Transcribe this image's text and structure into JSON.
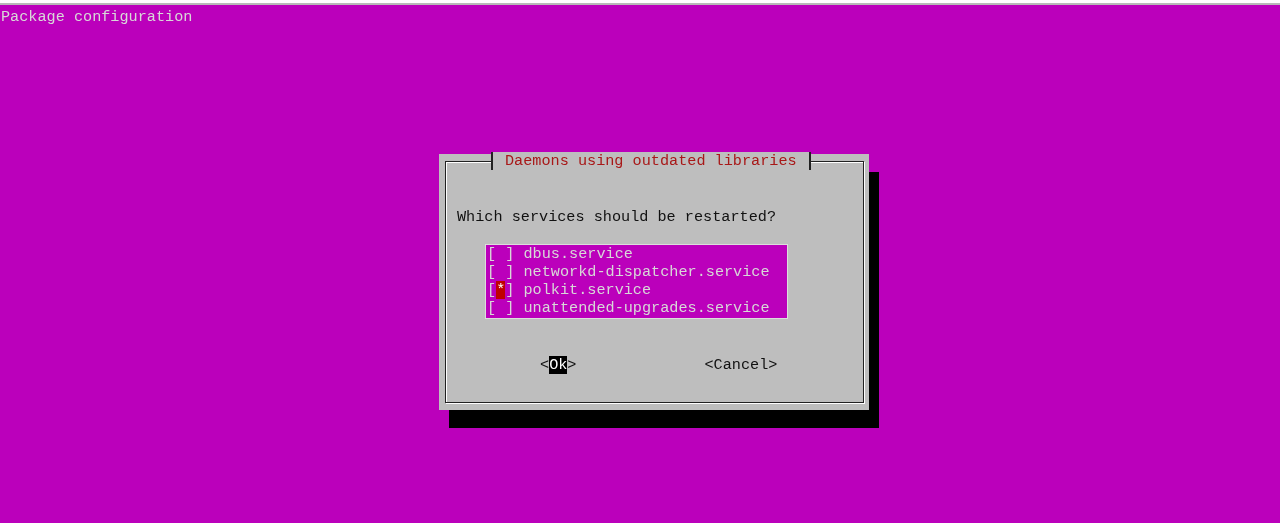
{
  "screen_title": "Package configuration",
  "dialog": {
    "title": "Daemons using outdated libraries",
    "prompt": "Which services should be restarted?",
    "checkbox_open": "[",
    "checkbox_close": "]",
    "check_symbol": "*",
    "items": [
      {
        "label": "dbus.service",
        "checked": false,
        "focused": false
      },
      {
        "label": "networkd-dispatcher.service",
        "checked": false,
        "focused": false
      },
      {
        "label": "polkit.service",
        "checked": true,
        "focused": true
      },
      {
        "label": "unattended-upgrades.service",
        "checked": false,
        "focused": false
      }
    ],
    "button_open": "<",
    "button_close": ">",
    "buttons": [
      {
        "label": "Ok",
        "selected": true
      },
      {
        "label": "Cancel",
        "selected": false
      }
    ]
  }
}
